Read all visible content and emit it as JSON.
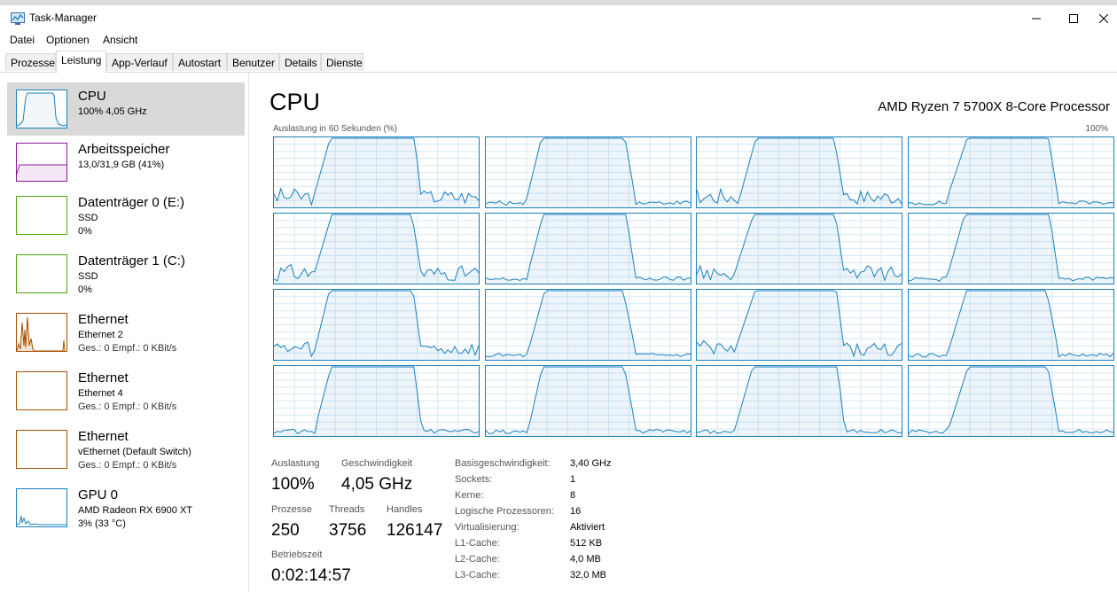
{
  "window": {
    "title": "Task-Manager"
  },
  "menu": [
    "Datei",
    "Optionen",
    "Ansicht"
  ],
  "tabs": [
    "Prozesse",
    "Leistung",
    "App-Verlauf",
    "Autostart",
    "Benutzer",
    "Details",
    "Dienste"
  ],
  "active_tab": "Leistung",
  "sidebar": {
    "items": [
      {
        "title": "CPU",
        "line1": "100% 4,05 GHz",
        "line2": "",
        "color": "#1b7fbd"
      },
      {
        "title": "Arbeitsspeicher",
        "line1": "13,0/31,9 GB (41%)",
        "line2": "",
        "color": "#8b179c"
      },
      {
        "title": "Datenträger 0 (E:)",
        "line1": "SSD",
        "line2": "0%",
        "color": "#4da60c"
      },
      {
        "title": "Datenträger 1 (C:)",
        "line1": "SSD",
        "line2": "0%",
        "color": "#4da60c"
      },
      {
        "title": "Ethernet",
        "line1": "Ethernet 2",
        "line2": "Ges.: 0 Empf.: 0 KBit/s",
        "color": "#a74f01"
      },
      {
        "title": "Ethernet",
        "line1": "Ethernet 4",
        "line2": "Ges.: 0 Empf.: 0 KBit/s",
        "color": "#a74f01"
      },
      {
        "title": "Ethernet",
        "line1": "vEthernet (Default Switch)",
        "line2": "Ges.: 0 Empf.: 0 KBit/s",
        "color": "#a74f01"
      },
      {
        "title": "GPU 0",
        "line1": "AMD Radeon RX 6900 XT",
        "line2": "3% (33 °C)",
        "color": "#1b7fbd"
      }
    ]
  },
  "main": {
    "title": "CPU",
    "processor": "AMD Ryzen 7 5700X 8-Core Processor",
    "util_label": "Auslastung in 60 Sekunden (%)",
    "util_max": "100%"
  },
  "stats": {
    "auslastung_label": "Auslastung",
    "auslastung_value": "100%",
    "geschw_label": "Geschwindigkeit",
    "geschw_value": "4,05 GHz",
    "prozesse_label": "Prozesse",
    "prozesse_value": "250",
    "threads_label": "Threads",
    "threads_value": "3756",
    "handles_label": "Handles",
    "handles_value": "126147",
    "betrieb_label": "Betriebszeit",
    "betrieb_value": "0:02:14:57"
  },
  "specs": [
    {
      "label": "Basisgeschwindigkeit:",
      "value": "3,40 GHz"
    },
    {
      "label": "Sockets:",
      "value": "1"
    },
    {
      "label": "Kerne:",
      "value": "8"
    },
    {
      "label": "Logische Prozessoren:",
      "value": "16"
    },
    {
      "label": "Virtualisierung:",
      "value": "Aktiviert"
    },
    {
      "label": "L1-Cache:",
      "value": "512 KB"
    },
    {
      "label": "L2-Cache:",
      "value": "4,0 MB"
    },
    {
      "label": "L3-Cache:",
      "value": "32,0 MB"
    }
  ],
  "accent": "#1b7fbd"
}
